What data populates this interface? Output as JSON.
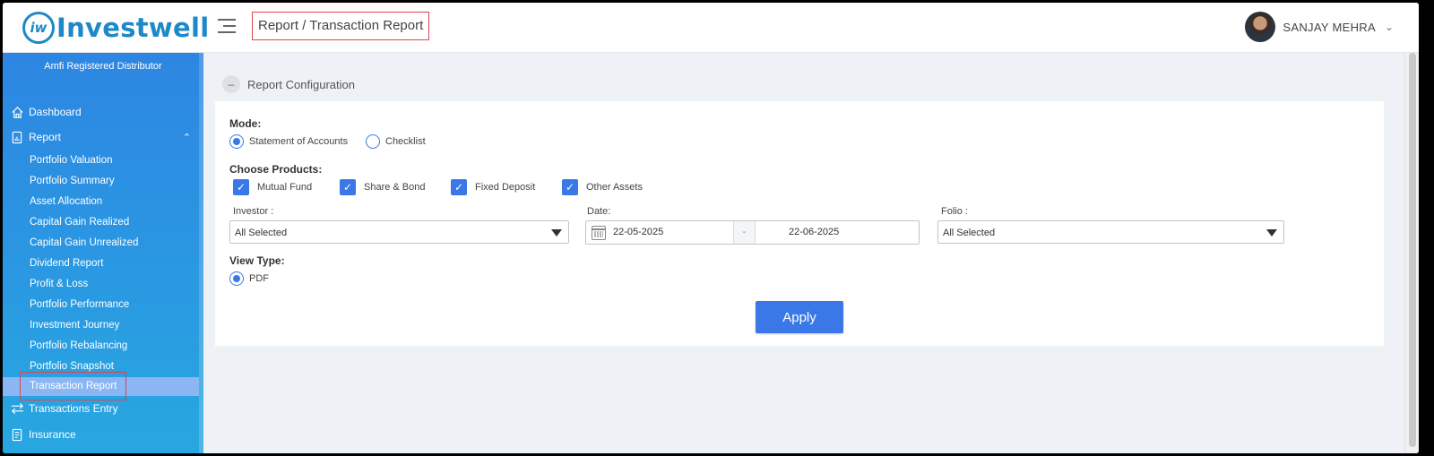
{
  "header": {
    "logo_text": "Investwell",
    "logo_mark": "iw",
    "breadcrumb": "Report / Transaction Report",
    "user_name": "SANJAY MEHRA"
  },
  "sidebar": {
    "distributor": "Amfi Registered Distributor",
    "dashboard": "Dashboard",
    "report": "Report",
    "report_items": [
      "Portfolio Valuation",
      "Portfolio Summary",
      "Asset Allocation",
      "Capital Gain Realized",
      "Capital Gain Unrealized",
      "Dividend Report",
      "Profit & Loss",
      "Portfolio Performance",
      "Investment Journey",
      "Portfolio Rebalancing",
      "Portfolio Snapshot",
      "Transaction Report"
    ],
    "transactions_entry": "Transactions Entry",
    "insurance": "Insurance"
  },
  "config": {
    "section_title": "Report Configuration",
    "mode_label": "Mode:",
    "mode_options": [
      "Statement of Accounts",
      "Checklist"
    ],
    "mode_selected": "Statement of Accounts",
    "products_label": "Choose Products:",
    "products": [
      "Mutual Fund",
      "Share & Bond",
      "Fixed Deposit",
      "Other Assets"
    ],
    "investor_label": "Investor :",
    "investor_value": "All Selected",
    "date_label": "Date:",
    "date_from": "22-05-2025",
    "date_sep": "-",
    "date_to": "22-06-2025",
    "folio_label": "Folio :",
    "folio_value": "All Selected",
    "view_type_label": "View Type:",
    "view_type_option": "PDF",
    "apply_label": "Apply"
  },
  "colors": {
    "accent": "#3b78e7",
    "brand": "#1e88c8",
    "sidebar_top": "#2d86e2",
    "sidebar_bottom": "#27a7e1",
    "highlight_border": "#e0454f"
  }
}
